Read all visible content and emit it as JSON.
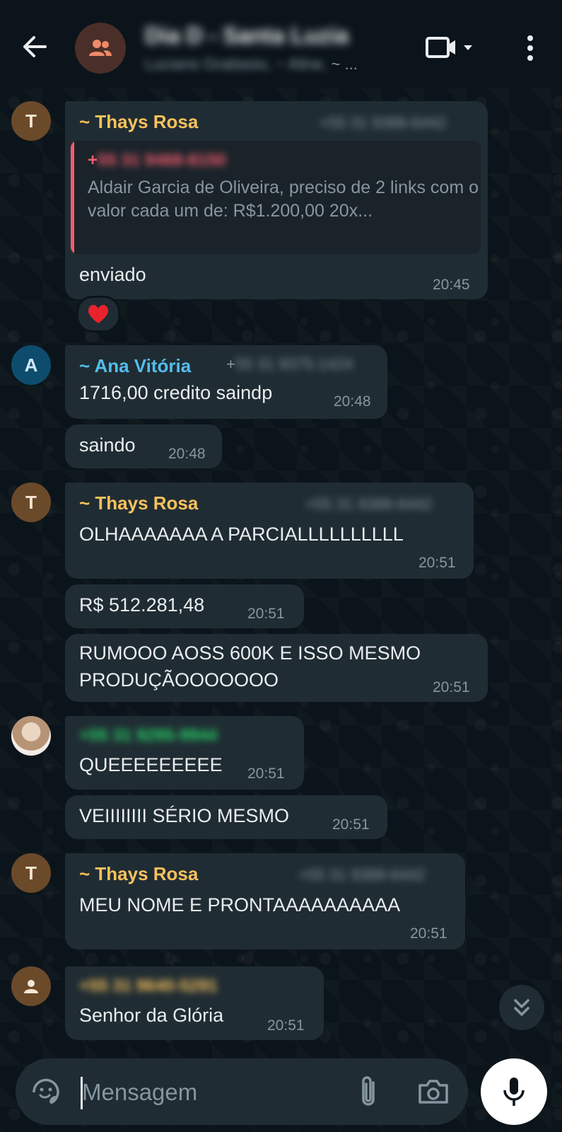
{
  "header": {
    "title": "Dia D - Santa Luzia",
    "subtitle_members": "Luciano Grattasio, ~ Aline,",
    "subtitle_more": " ~ ..."
  },
  "messages": [
    {
      "sender": "~ Thays Rosa",
      "avatar_letter": "T",
      "phone": "+55 31 9388-6442",
      "quote": {
        "author_prefix": "+",
        "author_phone": "55 31 9468-8150",
        "text": "Aldair Garcia de Oliveira, preciso de 2 links com o valor cada um de: R$1.200,00  20x..."
      },
      "text": "enviado",
      "time": "20:45",
      "reaction": "❤️"
    },
    {
      "sender": "~ Ana Vitória",
      "avatar_letter": "A",
      "phone_prefix": "+",
      "phone": "55 31 9375-1424",
      "text": "1716,00 credito saindp",
      "time": "20:48"
    },
    {
      "text": "saindo",
      "time": "20:48"
    },
    {
      "sender": "~ Thays Rosa",
      "avatar_letter": "T",
      "phone": "+55 31 9388-6442",
      "text": "OLHAAAAAAA A PARCIALLLLLLLLLL",
      "time": "20:51"
    },
    {
      "text": "R$ 512.281,48",
      "time": "20:51"
    },
    {
      "text_line1": "RUMOOO AOSS 600K E ISSO MESMO",
      "text_line2": "PRODUÇÃOOOOOOO",
      "time": "20:51"
    },
    {
      "phone": "+55 31 9295-9944",
      "text": "QUEEEEEEEEE",
      "time": "20:51"
    },
    {
      "text": "VEIIIIIIII SÉRIO MESMO",
      "time": "20:51"
    },
    {
      "sender": "~ Thays Rosa",
      "avatar_letter": "T",
      "phone": "+55 31 9388-6442",
      "text": "MEU  NOME E PRONTAAAAAAAAAA",
      "time": "20:51"
    },
    {
      "phone": "+55 31 9640-5291",
      "text": "Senhor da Glória",
      "time": "20:51"
    }
  ],
  "input": {
    "placeholder": "Mensagem"
  },
  "colors": {
    "background": "#0b141a",
    "bubble": "#202c33",
    "thays": "#f7c25c",
    "ana": "#53bdeb",
    "green_phone": "#25d366",
    "quote_accent": "#f15c6d"
  },
  "icons": {
    "back": "arrow-left",
    "group": "group",
    "video": "video-camera",
    "menu": "more-vertical",
    "emoji": "sticker",
    "attach": "paperclip",
    "camera": "camera",
    "mic": "microphone",
    "scroll": "chevrons-down"
  }
}
